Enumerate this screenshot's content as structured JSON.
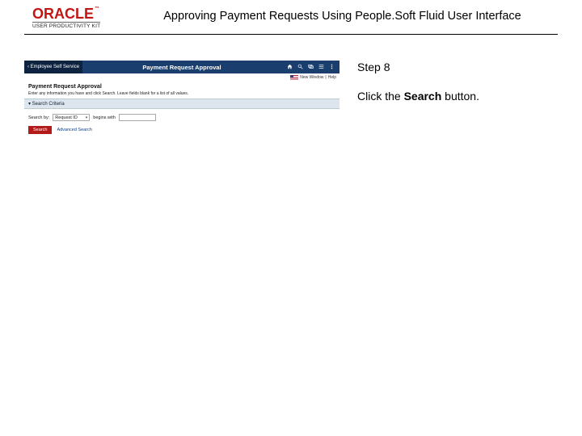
{
  "header": {
    "logo_text": "ORACLE",
    "logo_sub": "USER PRODUCTIVITY KIT",
    "title": "Approving Payment Requests Using People.Soft Fluid User Interface"
  },
  "screenshot": {
    "topbar": {
      "back_label": "‹  Employee Self Service",
      "page_title": "Payment Request Approval"
    },
    "flag_row": {
      "new_window": "New Window",
      "help": "Help"
    },
    "page_title": "Payment Request Approval",
    "helper_text": "Enter any information you have and click Search. Leave fields blank for a list of all values.",
    "section_label": "▾ Search Criteria",
    "search_row": {
      "label": "Search by:",
      "select_value": "Request ID",
      "begins_with": "begins with"
    },
    "buttons": {
      "search": "Search",
      "advanced": "Advanced Search"
    }
  },
  "instructions": {
    "step_label": "Step 8",
    "line_prefix": "Click the ",
    "line_bold": "Search",
    "line_suffix": " button."
  }
}
